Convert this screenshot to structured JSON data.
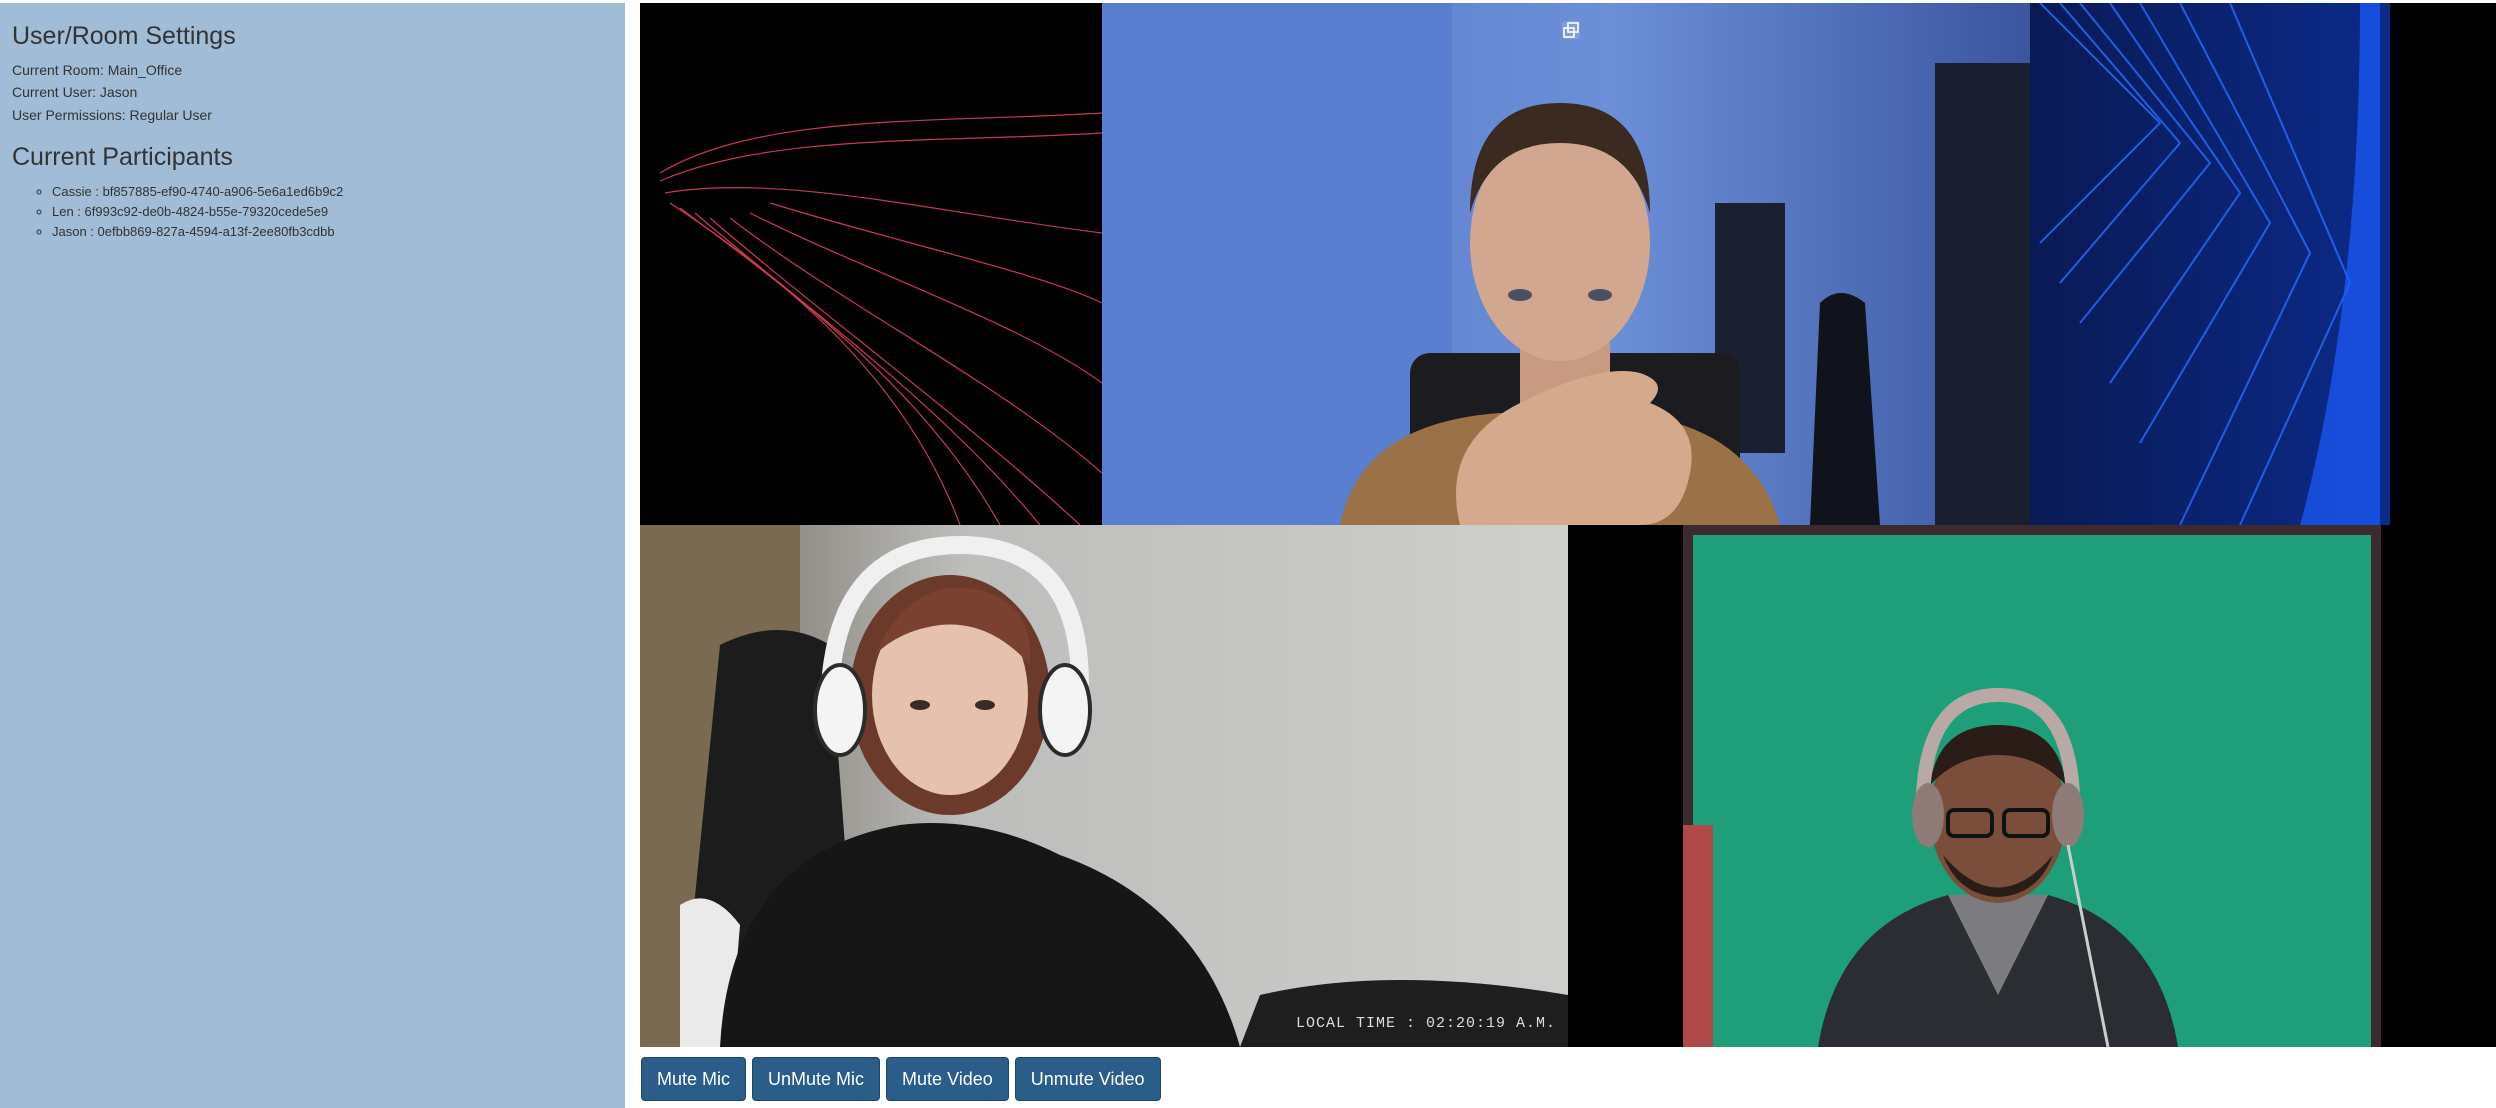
{
  "sidebar": {
    "title": "User/Room Settings",
    "current_room": "Current Room: Main_Office",
    "current_user": "Current User: Jason",
    "user_permissions": "User Permissions: Regular User",
    "participants_title": "Current Participants",
    "participants": [
      "Cassie : bf857885-ef90-4740-a906-5e6a1ed6b9c2",
      "Len : 6f993c92-de0b-4824-b55e-79320cede5e9",
      "Jason : 0efbb869-827a-4594-a13f-2ee80fb3cdbb"
    ]
  },
  "video_overlay": {
    "local_time": "LOCAL TIME : 02:20:19 A.M."
  },
  "controls": {
    "mute_mic": "Mute Mic",
    "unmute_mic": "UnMute Mic",
    "mute_video": "Mute Video",
    "unmute_video": "Unmute Video"
  },
  "colors": {
    "sidebar_bg": "#a0bcd6",
    "button_bg": "#2b5d8a",
    "green_screen": "#1f9e7a"
  }
}
